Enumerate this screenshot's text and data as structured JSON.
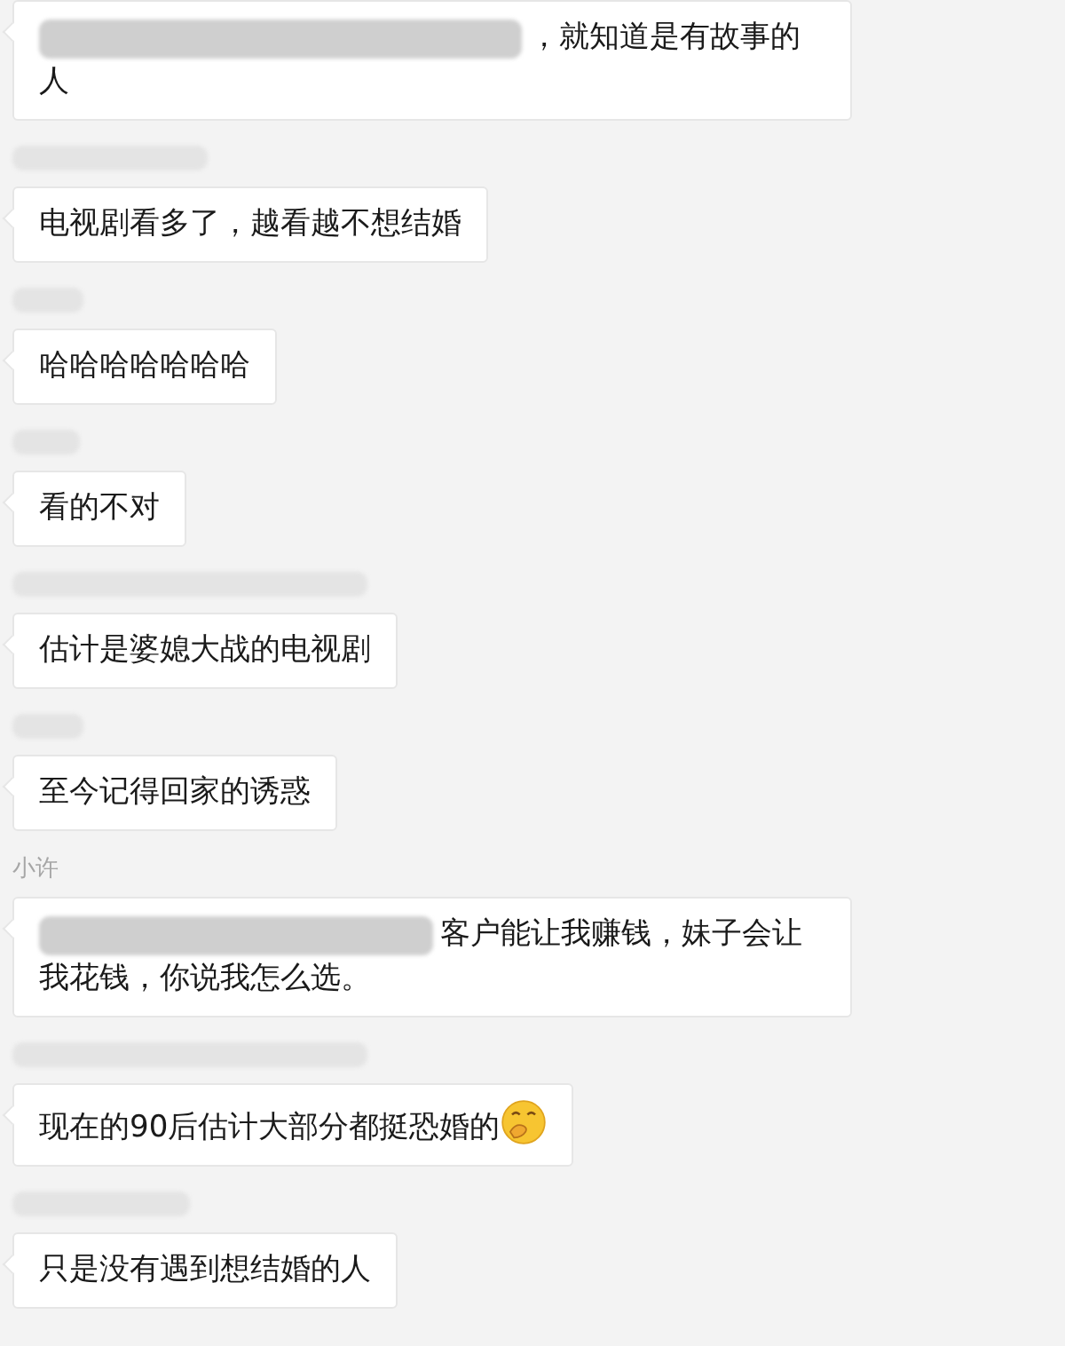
{
  "messages": [
    {
      "sender": {
        "kind": "none"
      },
      "bubble": {
        "redacted_prefix": true,
        "text": "，就知道是有故事的人",
        "emoji": false
      }
    },
    {
      "sender": {
        "kind": "redacted"
      },
      "bubble": {
        "redacted_prefix": false,
        "text": "电视剧看多了，越看越不想结婚",
        "emoji": false
      }
    },
    {
      "sender": {
        "kind": "redacted"
      },
      "bubble": {
        "redacted_prefix": false,
        "text": "哈哈哈哈哈哈哈",
        "emoji": false
      }
    },
    {
      "sender": {
        "kind": "redacted"
      },
      "bubble": {
        "redacted_prefix": false,
        "text": "看的不对",
        "emoji": false
      }
    },
    {
      "sender": {
        "kind": "redacted"
      },
      "bubble": {
        "redacted_prefix": false,
        "text": "估计是婆媳大战的电视剧",
        "emoji": false
      }
    },
    {
      "sender": {
        "kind": "redacted"
      },
      "bubble": {
        "redacted_prefix": false,
        "text": "至今记得回家的诱惑",
        "emoji": false
      }
    },
    {
      "sender": {
        "kind": "name",
        "text": "小许"
      },
      "bubble": {
        "redacted_prefix": true,
        "text": "客户能让我赚钱，妹子会让我花钱，你说我怎么选。",
        "emoji": false
      }
    },
    {
      "sender": {
        "kind": "redacted"
      },
      "bubble": {
        "redacted_prefix": false,
        "text": "现在的90后估计大部分都挺恐婚的",
        "emoji": true
      }
    },
    {
      "sender": {
        "kind": "redacted"
      },
      "bubble": {
        "redacted_prefix": false,
        "text": "只是没有遇到想结婚的人",
        "emoji": false
      }
    }
  ]
}
